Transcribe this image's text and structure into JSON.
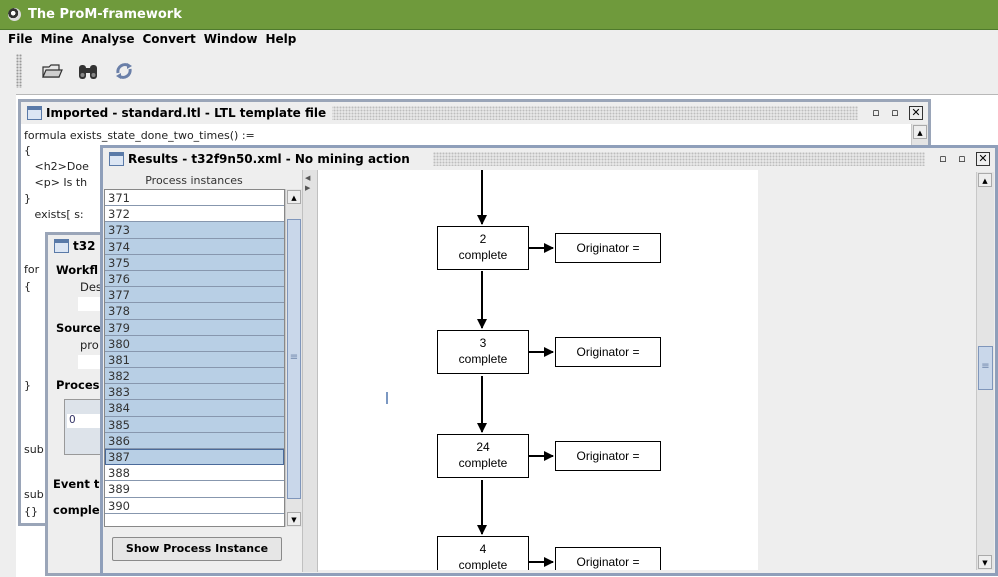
{
  "app": {
    "title": "The ProM-framework"
  },
  "menu": [
    "File",
    "Mine",
    "Analyse",
    "Convert",
    "Window",
    "Help"
  ],
  "toolbar": {
    "icons": [
      "open-folder-icon",
      "binoculars-icon",
      "refresh-icon"
    ]
  },
  "frame_ltl": {
    "title": "Imported - standard.ltl - LTL template file",
    "lines": [
      "formula exists_state_done_two_times() :=",
      "{",
      "   <h2>Doe",
      "   <p> Is th",
      "}",
      "   exists[ s:"
    ],
    "more_lines": [
      "for",
      "{",
      "}",
      "sub",
      "sub",
      "{}"
    ]
  },
  "frame_t32": {
    "title": "t32",
    "labels": {
      "workflow": "Workfl",
      "workflow_value": "Des",
      "source": "Source",
      "source_value": "pro",
      "process": "Proces",
      "process_cell": "0",
      "event": "Event t",
      "complete": "comple"
    }
  },
  "frame_results": {
    "title": "Results - t32f9n50.xml - No mining action",
    "list_header": "Process instances",
    "instances": [
      "371",
      "372",
      "373",
      "374",
      "375",
      "376",
      "377",
      "378",
      "379",
      "380",
      "381",
      "382",
      "383",
      "384",
      "385",
      "386",
      "387",
      "388",
      "389",
      "390"
    ],
    "selected_instances": [
      "373",
      "374",
      "375",
      "376",
      "377",
      "378",
      "379",
      "380",
      "381",
      "382",
      "383",
      "384",
      "385",
      "386",
      "387"
    ],
    "focused_instance": "387",
    "show_button": "Show Process Instance",
    "graph": {
      "nodes": [
        {
          "id": "2",
          "label": "complete",
          "originator": "Originator ="
        },
        {
          "id": "3",
          "label": "complete",
          "originator": "Originator ="
        },
        {
          "id": "24",
          "label": "complete",
          "originator": "Originator ="
        },
        {
          "id": "4",
          "label": "complete",
          "originator": "Originator ="
        }
      ]
    }
  },
  "colors": {
    "title_green": "#6f9a3c",
    "selection": "#b8cfe5",
    "frame_border": "#9aa5b8"
  }
}
